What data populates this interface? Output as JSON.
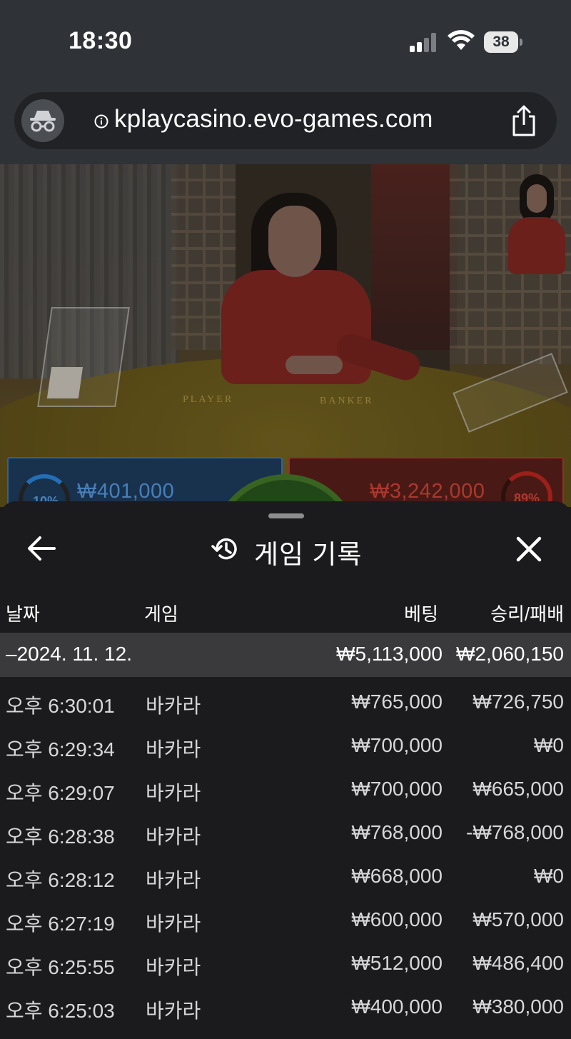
{
  "status_bar": {
    "time": "18:30",
    "battery": "38",
    "icons": [
      "signal-icon",
      "wifi-icon",
      "battery-icon"
    ]
  },
  "browser": {
    "url": "kplaycasino.evo-games.com",
    "icons": [
      "incognito-icon",
      "info-icon",
      "share-icon"
    ]
  },
  "video": {
    "felt_player": "PLAYER",
    "felt_banker": "BANKER",
    "player_pct": "10%",
    "player_bet": "₩401,000",
    "banker_bet": "₩3,242,000",
    "banker_pct": "89%",
    "player_color": "#3a7fc9",
    "banker_color": "#c23a32"
  },
  "sheet": {
    "title": "게임 기록",
    "icons": [
      "back-arrow-icon",
      "history-icon",
      "close-icon"
    ],
    "columns": {
      "date": "날짜",
      "game": "게임",
      "bet": "베팅",
      "winloss": "승리/패배"
    },
    "date_group": {
      "date": "–2024. 11. 12.",
      "total_bet": "₩5,113,000",
      "total_winloss": "₩2,060,150"
    },
    "rows": [
      {
        "time": "오후 6:30:01",
        "game": "바카라",
        "bet": "₩765,000",
        "winloss": "₩726,750"
      },
      {
        "time": "오후 6:29:34",
        "game": "바카라",
        "bet": "₩700,000",
        "winloss": "₩0"
      },
      {
        "time": "오후 6:29:07",
        "game": "바카라",
        "bet": "₩700,000",
        "winloss": "₩665,000"
      },
      {
        "time": "오후 6:28:38",
        "game": "바카라",
        "bet": "₩768,000",
        "winloss": "-₩768,000"
      },
      {
        "time": "오후 6:28:12",
        "game": "바카라",
        "bet": "₩668,000",
        "winloss": "₩0"
      },
      {
        "time": "오후 6:27:19",
        "game": "바카라",
        "bet": "₩600,000",
        "winloss": "₩570,000"
      },
      {
        "time": "오후 6:25:55",
        "game": "바카라",
        "bet": "₩512,000",
        "winloss": "₩486,400"
      },
      {
        "time": "오후 6:25:03",
        "game": "바카라",
        "bet": "₩400,000",
        "winloss": "₩380,000"
      }
    ]
  }
}
